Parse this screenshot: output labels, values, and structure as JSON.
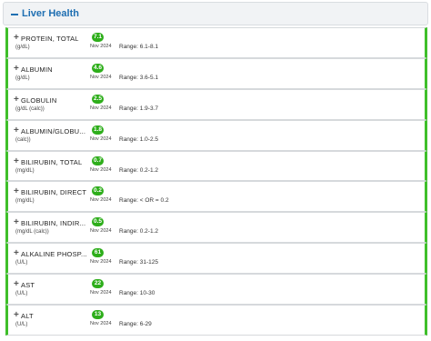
{
  "panel": {
    "title": "Liver Health",
    "accent_color": "#1f6fb2",
    "status_color": "#2eae1b"
  },
  "tests": [
    {
      "name": "PROTEIN, TOTAL",
      "unit": "(g/dL)",
      "value": "7.1",
      "date": "Nov 2024",
      "range": "Range: 6.1-8.1"
    },
    {
      "name": "ALBUMIN",
      "unit": "(g/dL)",
      "value": "4.6",
      "date": "Nov 2024",
      "range": "Range: 3.6-5.1"
    },
    {
      "name": "GLOBULIN",
      "unit": "(g/dL (calc))",
      "value": "2.5",
      "date": "Nov 2024",
      "range": "Range: 1.9-3.7"
    },
    {
      "name": "ALBUMIN/GLOBU...",
      "unit": "(calc))",
      "value": "1.8",
      "date": "Nov 2024",
      "range": "Range: 1.0-2.5"
    },
    {
      "name": "BILIRUBIN, TOTAL",
      "unit": "(mg/dL)",
      "value": "0.7",
      "date": "Nov 2024",
      "range": "Range: 0.2-1.2"
    },
    {
      "name": "BILIRUBIN, DIRECT",
      "unit": "(mg/dL)",
      "value": "0.2",
      "date": "Nov 2024",
      "range": "Range: < OR = 0.2"
    },
    {
      "name": "BILIRUBIN, INDIR...",
      "unit": "(mg/dL (calc))",
      "value": "0.5",
      "date": "Nov 2024",
      "range": "Range: 0.2-1.2"
    },
    {
      "name": "ALKALINE PHOSP...",
      "unit": "(U/L)",
      "value": "61",
      "date": "Nov 2024",
      "range": "Range: 31-125"
    },
    {
      "name": "AST",
      "unit": "(U/L)",
      "value": "22",
      "date": "Nov 2024",
      "range": "Range: 10-30"
    },
    {
      "name": "ALT",
      "unit": "(U/L)",
      "value": "13",
      "date": "Nov 2024",
      "range": "Range: 6-29"
    }
  ]
}
